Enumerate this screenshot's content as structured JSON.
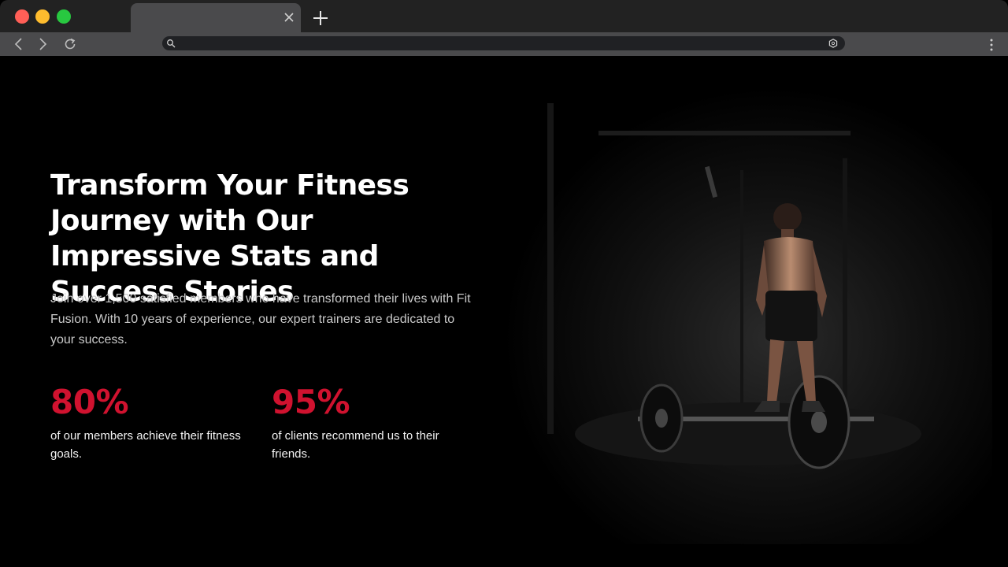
{
  "browser": {
    "tab_title": "",
    "address": ""
  },
  "hero": {
    "title": "Transform Your Fitness Journey with Our Impressive Stats and Success Stories",
    "description": "Join over 1,500 satisfied members who have transformed their lives with Fit Fusion. With 10 years of experience, our expert trainers are dedicated to your success.",
    "image_subject": "athlete-with-barbell-in-dark-gym"
  },
  "stats": [
    {
      "value": "80%",
      "text": "of our members achieve their fitness goals."
    },
    {
      "value": "95%",
      "text": "of clients recommend us to their friends."
    }
  ],
  "colors": {
    "accent": "#d0122f",
    "background": "#000000",
    "heading": "#ffffff"
  },
  "icons": {
    "close": "close-icon",
    "new_tab": "plus-icon",
    "back": "back-icon",
    "forward": "forward-icon",
    "reload": "reload-icon",
    "search": "search-icon",
    "extension": "extension-icon",
    "menu": "menu-icon"
  }
}
